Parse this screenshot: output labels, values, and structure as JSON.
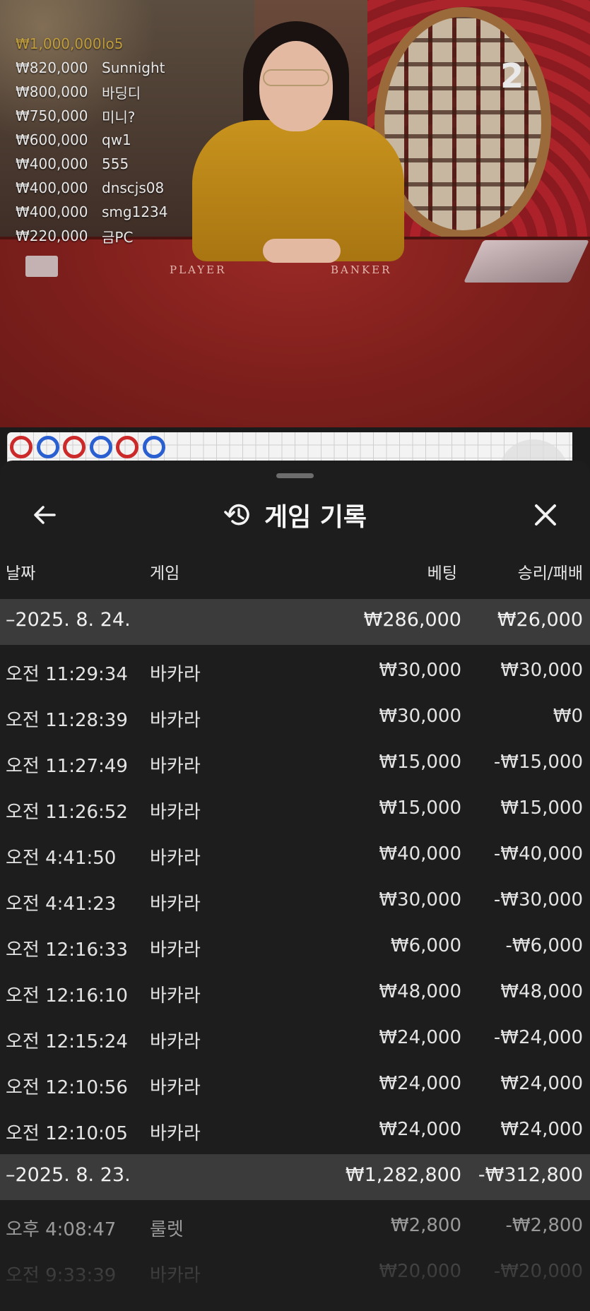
{
  "stream": {
    "round_number": "2",
    "table_labels": {
      "player": "PLAYER",
      "banker": "BANKER"
    },
    "winners": [
      {
        "amount": "₩1,000,000",
        "name": "lo5"
      },
      {
        "amount": "₩820,000",
        "name": "Sunnight"
      },
      {
        "amount": "₩800,000",
        "name": "바딩디"
      },
      {
        "amount": "₩750,000",
        "name": "미니?"
      },
      {
        "amount": "₩600,000",
        "name": "qw1"
      },
      {
        "amount": "₩400,000",
        "name": "555"
      },
      {
        "amount": "₩400,000",
        "name": "dnscjs08"
      },
      {
        "amount": "₩400,000",
        "name": "smg1234"
      },
      {
        "amount": "₩220,000",
        "name": "금PC"
      }
    ]
  },
  "road": {
    "results": [
      "banker",
      "player",
      "banker",
      "player",
      "banker",
      "player"
    ],
    "colors": {
      "banker": "#cc2a2a",
      "player": "#2a5fd1"
    }
  },
  "sheet": {
    "title": "게임 기록",
    "icons": {
      "back": "arrow-left-icon",
      "history": "history-icon",
      "close": "close-icon"
    },
    "columns": {
      "date": "날짜",
      "game": "게임",
      "bet": "베팅",
      "result": "승리/패배"
    },
    "groups": [
      {
        "date": "–2025. 8. 24.",
        "bet_total": "₩286,000",
        "result_total": "₩26,000",
        "rows": [
          {
            "time": "오전 11:29:34",
            "game": "바카라",
            "bet": "₩30,000",
            "result": "₩30,000"
          },
          {
            "time": "오전 11:28:39",
            "game": "바카라",
            "bet": "₩30,000",
            "result": "₩0"
          },
          {
            "time": "오전 11:27:49",
            "game": "바카라",
            "bet": "₩15,000",
            "result": "-₩15,000"
          },
          {
            "time": "오전 11:26:52",
            "game": "바카라",
            "bet": "₩15,000",
            "result": "₩15,000"
          },
          {
            "time": "오전 4:41:50",
            "game": "바카라",
            "bet": "₩40,000",
            "result": "-₩40,000"
          },
          {
            "time": "오전 4:41:23",
            "game": "바카라",
            "bet": "₩30,000",
            "result": "-₩30,000"
          },
          {
            "time": "오전 12:16:33",
            "game": "바카라",
            "bet": "₩6,000",
            "result": "-₩6,000"
          },
          {
            "time": "오전 12:16:10",
            "game": "바카라",
            "bet": "₩48,000",
            "result": "₩48,000"
          },
          {
            "time": "오전 12:15:24",
            "game": "바카라",
            "bet": "₩24,000",
            "result": "-₩24,000"
          },
          {
            "time": "오전 12:10:56",
            "game": "바카라",
            "bet": "₩24,000",
            "result": "₩24,000"
          },
          {
            "time": "오전 12:10:05",
            "game": "바카라",
            "bet": "₩24,000",
            "result": "₩24,000"
          }
        ]
      },
      {
        "date": "–2025. 8. 23.",
        "bet_total": "₩1,282,800",
        "result_total": "-₩312,800",
        "rows": [
          {
            "time": "오후 4:08:47",
            "game": "룰렛",
            "bet": "₩2,800",
            "result": "-₩2,800"
          },
          {
            "time": "오전 9:33:39",
            "game": "바카라",
            "bet": "₩20,000",
            "result": "-₩20,000"
          }
        ]
      }
    ]
  }
}
